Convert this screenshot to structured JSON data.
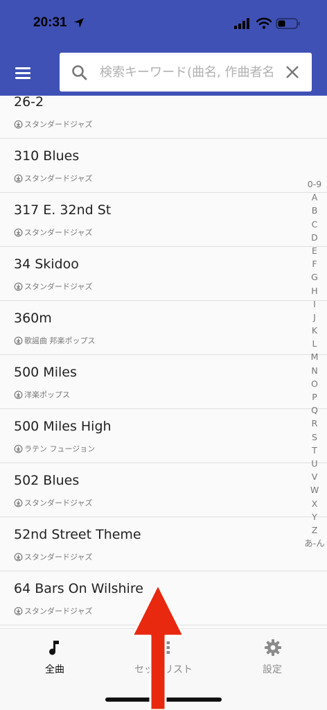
{
  "status_bar": {
    "time": "20:31"
  },
  "search": {
    "placeholder": "検索キーワード(曲名, 作曲者名)"
  },
  "songs": [
    {
      "title": "26-2",
      "genre": "スタンダードジャズ"
    },
    {
      "title": "310 Blues",
      "genre": "スタンダードジャズ"
    },
    {
      "title": "317 E. 32nd St",
      "genre": "スタンダードジャズ"
    },
    {
      "title": "34 Skidoo",
      "genre": "スタンダードジャズ"
    },
    {
      "title": "360m",
      "genre": "歌謡曲 邦楽ポップス"
    },
    {
      "title": "500 Miles",
      "genre": "洋楽ポップス"
    },
    {
      "title": "500 Miles High",
      "genre": "ラテン フュージョン"
    },
    {
      "title": "502 Blues",
      "genre": "スタンダードジャズ"
    },
    {
      "title": "52nd Street Theme",
      "genre": "スタンダードジャズ"
    },
    {
      "title": "64 Bars On Wilshire",
      "genre": "スタンダードジャズ"
    }
  ],
  "index": [
    "0-9",
    "A",
    "B",
    "C",
    "D",
    "E",
    "F",
    "G",
    "H",
    "I",
    "J",
    "K",
    "L",
    "M",
    "N",
    "O",
    "P",
    "Q",
    "R",
    "S",
    "T",
    "U",
    "V",
    "W",
    "X",
    "Y",
    "Z",
    "あ-ん"
  ],
  "bottom_nav": {
    "all_songs": "全曲",
    "setlist": "セットリスト",
    "settings": "設定"
  },
  "colors": {
    "appbar": "#3f51b5",
    "arrow": "#e8290f"
  }
}
